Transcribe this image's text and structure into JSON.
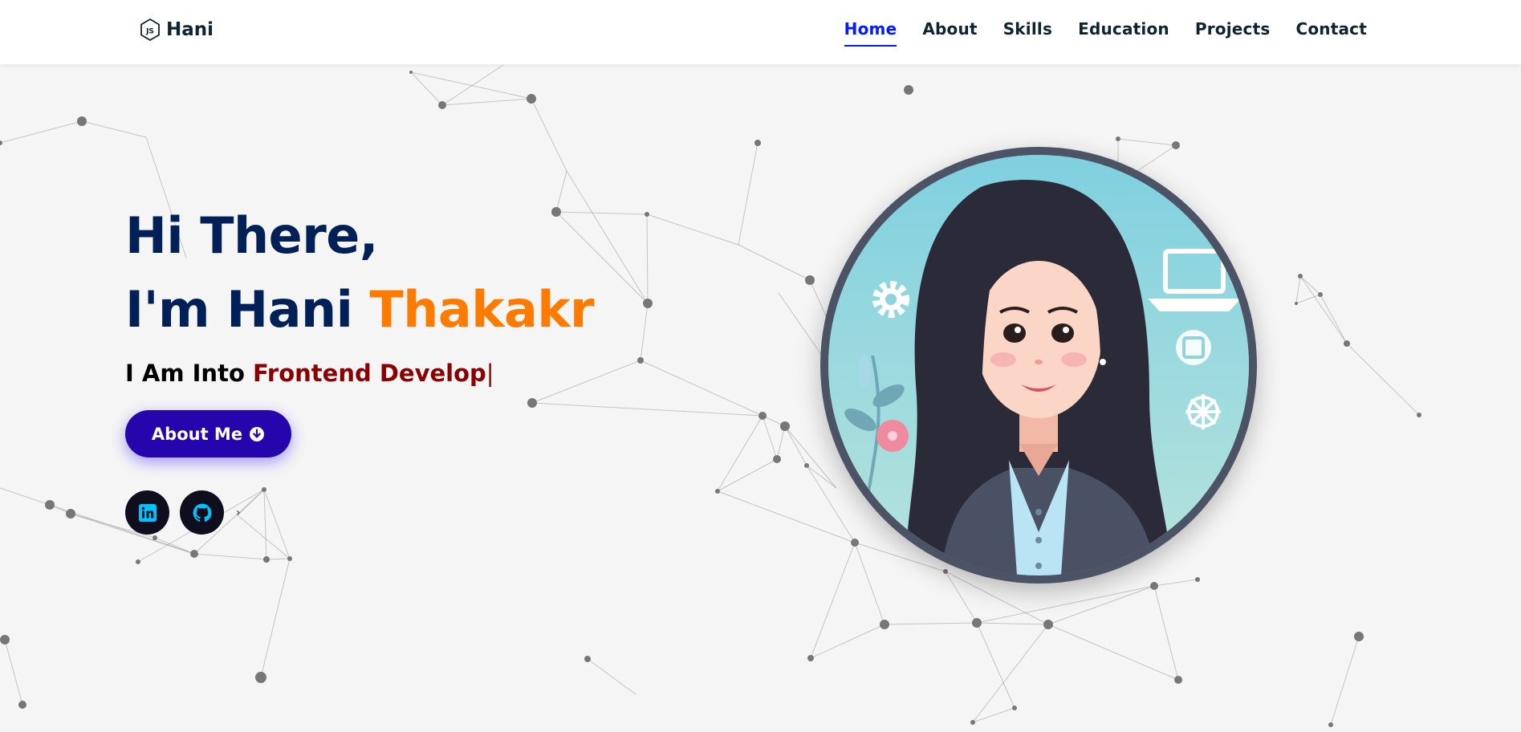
{
  "header": {
    "logo_text": "Hani",
    "nav": [
      {
        "label": "Home",
        "active": true
      },
      {
        "label": "About",
        "active": false
      },
      {
        "label": "Skills",
        "active": false
      },
      {
        "label": "Education",
        "active": false
      },
      {
        "label": "Projects",
        "active": false
      },
      {
        "label": "Contact",
        "active": false
      }
    ]
  },
  "hero": {
    "greeting": "Hi There,",
    "intro_prefix": "I'm Hani ",
    "intro_accent": "Thakakr",
    "typing_prefix": "I Am Into ",
    "typing_text": "Frontend Develop",
    "typing_cursor": "|",
    "button_label": "About Me",
    "more_indicator": "›"
  },
  "colors": {
    "heading": "#002057",
    "accent": "#ff7b00",
    "typed": "#8b0000",
    "button": "#2506ad",
    "nav_active": "#011aff",
    "social_bg": "#0e0e1e",
    "social_icon": "#00c3ff"
  },
  "icons": {
    "logo": "js-hexagon-icon",
    "button": "arrow-circle-down-icon",
    "social": [
      "linkedin-icon",
      "github-icon"
    ]
  }
}
